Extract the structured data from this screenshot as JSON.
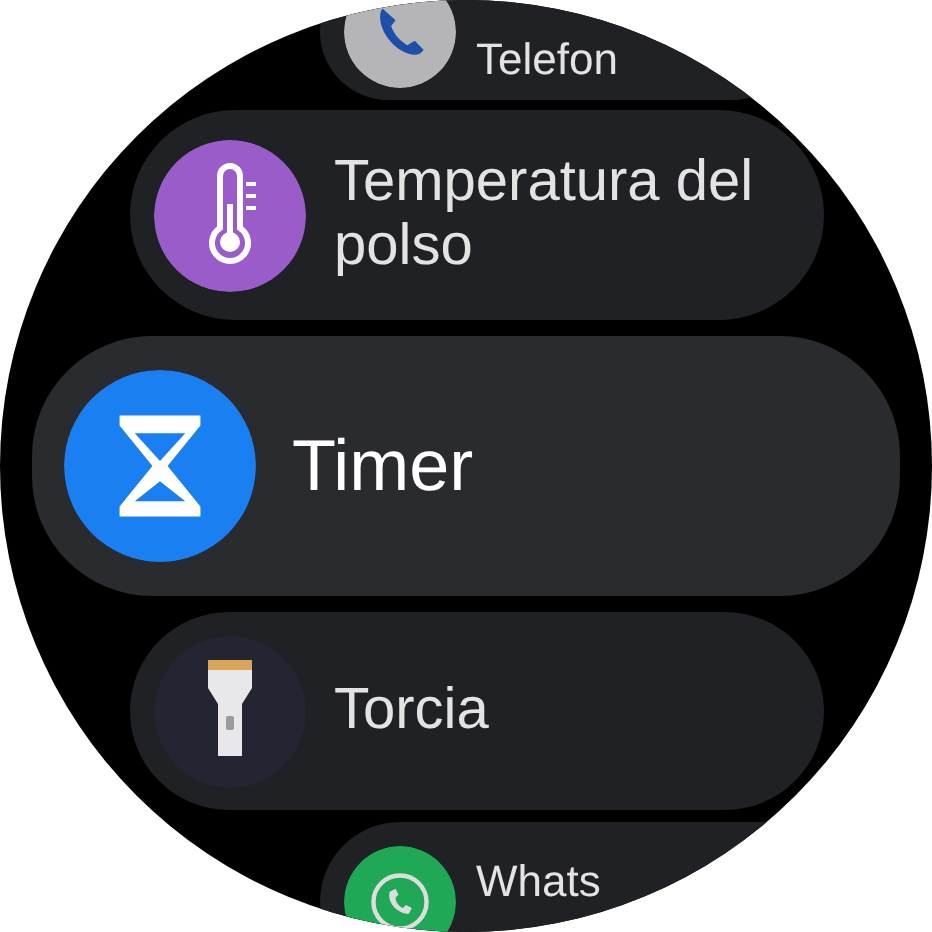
{
  "apps": [
    {
      "label": "Telefon",
      "kind": "phone",
      "selected": false
    },
    {
      "label": "Temperatura del polso",
      "kind": "thermometer",
      "selected": false
    },
    {
      "label": "Timer",
      "kind": "hourglass",
      "selected": true
    },
    {
      "label": "Torcia",
      "kind": "flashlight",
      "selected": false
    },
    {
      "label": "Whats",
      "kind": "chat",
      "selected": false
    }
  ]
}
